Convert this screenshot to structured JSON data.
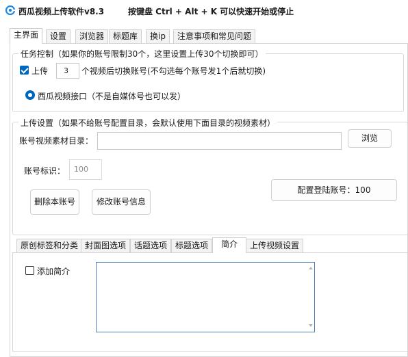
{
  "window": {
    "title": "西瓜视频上传软件v8.3",
    "hotkey_hint": "按键盘 Ctrl + Alt + K  可以快速开始或停止",
    "icon": "app-logo-icon",
    "accent": "#0067c0"
  },
  "tabs": [
    {
      "label": "主界面",
      "active": true
    },
    {
      "label": "设置",
      "active": false
    },
    {
      "label": "浏览器",
      "active": false
    },
    {
      "label": "标题库",
      "active": false
    },
    {
      "label": "换ip",
      "active": false
    },
    {
      "label": "注意事项和常见问题",
      "active": false
    }
  ],
  "task_control": {
    "title": "任务控制（如果你的账号限制30个，这里设置上传30个切换即可）",
    "upload_checkbox_label": "上传",
    "upload_checked": true,
    "switch_count": "3",
    "switch_suffix": "个视频后切换账号(不勾选每个账号发1个后就切换)",
    "api_radio_label": "西瓜视频接口（不是自媒体号也可以发）",
    "api_radio_selected": true
  },
  "upload_settings": {
    "title": "上传设置（如果不给账号配置目录，会默认使用下面目录的视频素材）",
    "dir_label": "账号视频素材目录：",
    "dir_value": "",
    "browse_button": "浏览",
    "account_id_label": "账号标识：",
    "account_id_value": "100",
    "delete_button": "删除本账号",
    "edit_button": "修改账号信息",
    "login_button_label": "配置登陆账号：",
    "login_button_value": "100"
  },
  "sub_tabs": [
    {
      "label": "原创标签和分类",
      "active": false
    },
    {
      "label": "封面图选项",
      "active": false
    },
    {
      "label": "话题选项",
      "active": false
    },
    {
      "label": "标题选项",
      "active": false
    },
    {
      "label": "简介",
      "active": true
    },
    {
      "label": "上传视频设置",
      "active": false
    }
  ],
  "intro_tab": {
    "add_intro_label": "添加简介",
    "add_intro_checked": false,
    "intro_text": ""
  }
}
